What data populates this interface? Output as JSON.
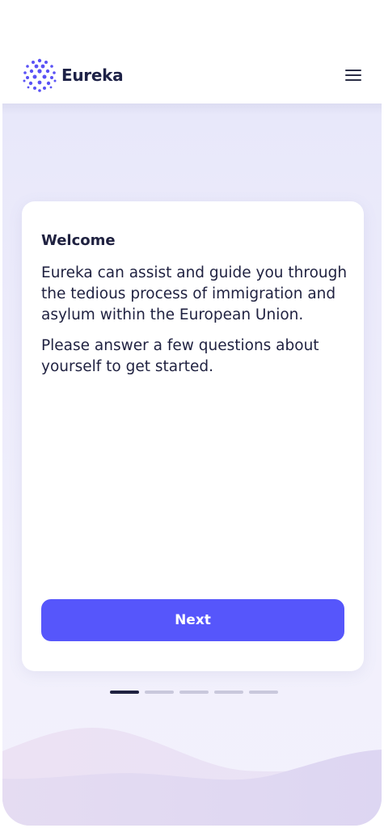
{
  "app": {
    "name": "Eureka",
    "logo_icon": "molecule-sphere-icon",
    "menu_icon": "hamburger-menu-icon"
  },
  "welcome_card": {
    "title": "Welcome",
    "paragraphs": [
      "Eureka can assist and guide you through the tedious process of immigration and asylum within the European Union.",
      "Please answer a few questions about yourself to get started."
    ],
    "next_label": "Next"
  },
  "pager": {
    "total_steps": 5,
    "current_step": 1
  },
  "colors": {
    "accent": "#5656fb",
    "text": "#1f2140",
    "background": "#ececfa",
    "logo": "#5a52f5"
  }
}
